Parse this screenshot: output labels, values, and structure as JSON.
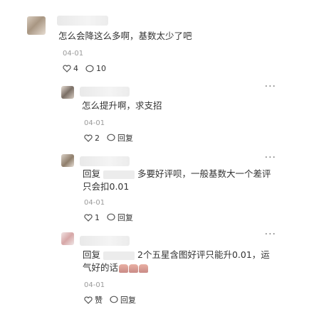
{
  "comments": [
    {
      "text": "怎么会降这么多啊，基数太少了吧",
      "date": "04-01",
      "likes": "4",
      "replies": "10"
    },
    {
      "text": "怎么提升啊，求支招",
      "date": "04-01",
      "likes": "2",
      "reply_label": "回复"
    },
    {
      "reply_prefix": "回复",
      "text": "多要好评呗，一般基数大一个差评只会扣0.01",
      "date": "04-01",
      "likes": "1",
      "reply_label": "回复"
    },
    {
      "reply_prefix": "回复",
      "text": "2个五星含图好评只能升0.01，运气好的话",
      "date": "04-01",
      "like_label": "赞",
      "reply_label": "回复"
    }
  ],
  "icons": {
    "more": "more-dots-icon",
    "like": "heart-outline-icon",
    "comment": "comment-bubble-icon",
    "emoji": "facepalm-emoji-icon"
  },
  "colors": {
    "text": "#333333",
    "meta": "#9a9a9a"
  }
}
